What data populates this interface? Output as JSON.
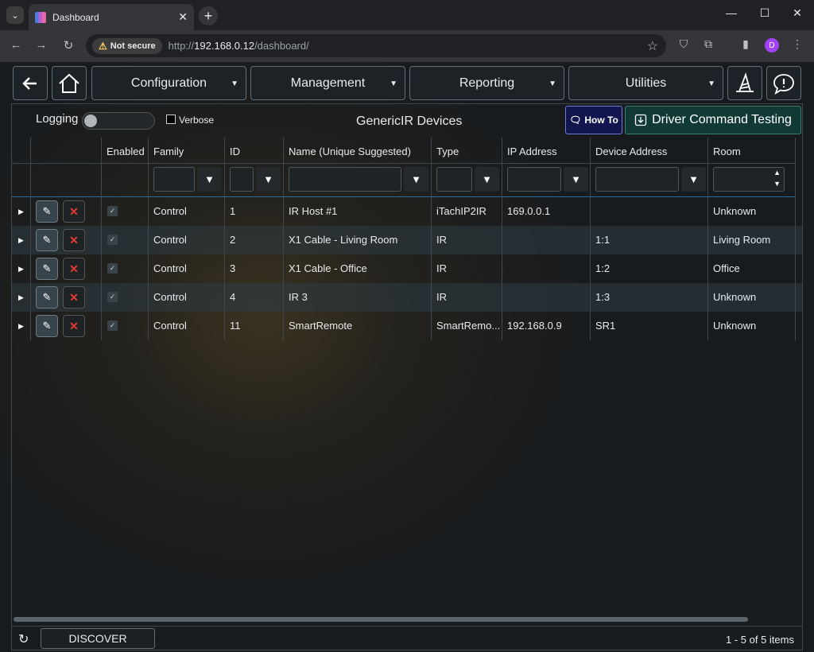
{
  "browser": {
    "tab_title": "Dashboard",
    "security_label": "Not secure",
    "url_prefix": "http://",
    "url_host": "192.168.0.12",
    "url_path": "/dashboard/",
    "profile_initial": "D"
  },
  "nav": {
    "menus": [
      "Configuration",
      "Management",
      "Reporting",
      "Utilities"
    ]
  },
  "panel": {
    "logging_label": "Logging",
    "logging_on": false,
    "verbose_label": "Verbose",
    "verbose_checked": false,
    "title": "GenericIR Devices",
    "howto_label": "How To",
    "driver_test_label": "Driver Command Testing"
  },
  "grid": {
    "columns": [
      "",
      "",
      "Enabled",
      "Family",
      "ID",
      "Name (Unique Suggested)",
      "Type",
      "IP Address",
      "Device Address",
      "Room"
    ],
    "rows": [
      {
        "enabled": true,
        "family": "Control",
        "id": "1",
        "name": "IR Host #1",
        "type": "iTachIP2IR",
        "ip": "169.0.0.1",
        "address": "",
        "room": "Unknown"
      },
      {
        "enabled": true,
        "family": "Control",
        "id": "2",
        "name": "X1 Cable - Living Room",
        "type": "IR",
        "ip": "",
        "address": "1:1",
        "room": "Living Room"
      },
      {
        "enabled": true,
        "family": "Control",
        "id": "3",
        "name": "X1 Cable - Office",
        "type": "IR",
        "ip": "",
        "address": "1:2",
        "room": "Office"
      },
      {
        "enabled": true,
        "family": "Control",
        "id": "4",
        "name": "IR 3",
        "type": "IR",
        "ip": "",
        "address": "1:3",
        "room": "Unknown"
      },
      {
        "enabled": true,
        "family": "Control",
        "id": "11",
        "name": "SmartRemote",
        "type": "SmartRemo...",
        "ip": "192.168.0.9",
        "address": "SR1",
        "room": "Unknown"
      }
    ]
  },
  "footer": {
    "discover_label": "DISCOVER",
    "pager_text": "1 - 5 of 5 items"
  }
}
